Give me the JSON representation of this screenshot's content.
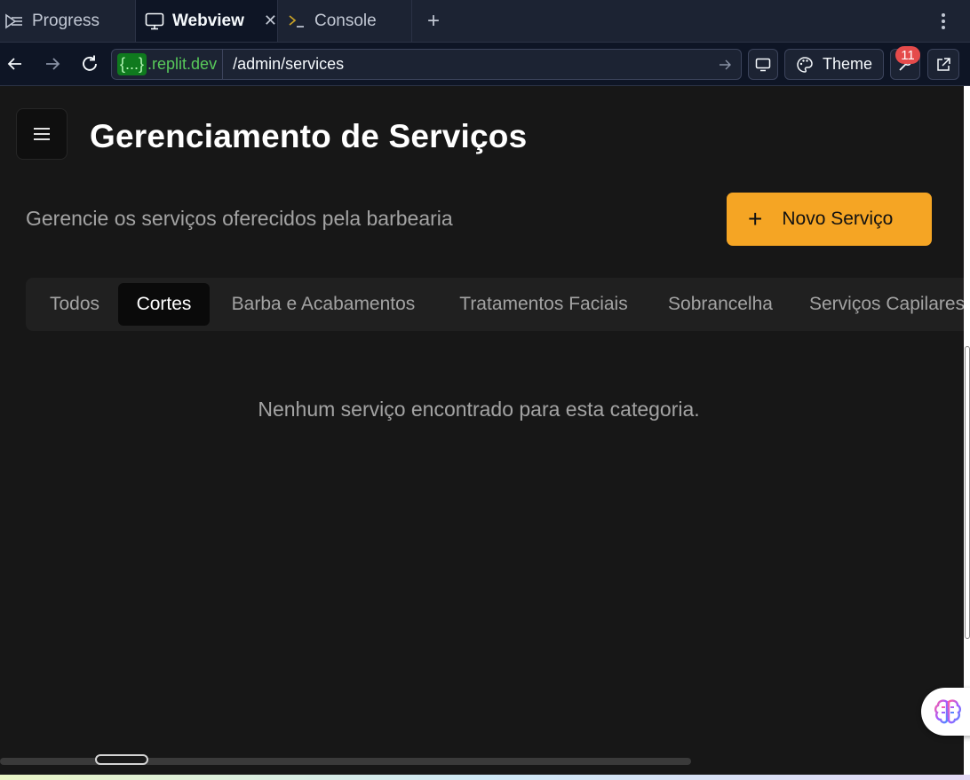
{
  "tabs": [
    {
      "label": "Progress",
      "icon": "progress-icon",
      "active": false
    },
    {
      "label": "Webview",
      "icon": "monitor-icon",
      "active": true
    },
    {
      "label": "Console",
      "icon": "terminal-icon",
      "active": false
    }
  ],
  "toolbar": {
    "domain_brace": "{...}",
    "domain": ".replit.dev",
    "path": "/admin/services",
    "theme_label": "Theme",
    "badge_count": "11"
  },
  "page": {
    "title": "Gerenciamento de Serviços",
    "subtitle": "Gerencie os serviços oferecidos pela barbearia",
    "new_button_label": "Novo Serviço",
    "new_button_color": "#f5a524",
    "categories": [
      "Todos",
      "Cortes",
      "Barba e Acabamentos",
      "Tratamentos Faciais",
      "Sobrancelha",
      "Serviços Capilares"
    ],
    "active_category": "Cortes",
    "empty_message": "Nenhum serviço encontrado para esta categoria."
  }
}
